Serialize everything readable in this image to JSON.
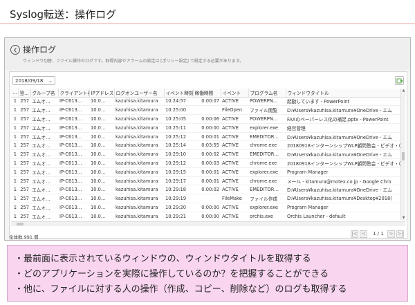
{
  "slide": {
    "title": "Syslog転送：操作ログ"
  },
  "window": {
    "title": "操作ログ",
    "description": "ウィンドウ切替、ファイル操作のログです。取得内容やアラームの設定は [ポリシー設定] で設定する必要があります。"
  },
  "filter": {
    "date": "2018/09/18"
  },
  "table": {
    "columns": [
      "…",
      "登…",
      "グループ名",
      "クライアント名",
      "IPアドレス",
      "ログオンユーザー名",
      "イベント時刻",
      "稼働時間",
      "イベント",
      "プログラム名",
      "ウィンドウタイトル"
    ],
    "rows": [
      [
        "1",
        "257",
        "エムオ…",
        "IP-C613…",
        "10.0…",
        "kazuhisa.kitamura",
        "10:24:57",
        "0:00:07",
        "ACTIVE",
        "POWERPN…",
        "起動しています - PowerPoint"
      ],
      [
        "1",
        "257",
        "エムオ…",
        "IP-C613…",
        "10.0…",
        "kazuhisa.kitamura",
        "10:25:00",
        "",
        "FileOpen",
        "ファイル閲覧",
        "D:¥Users¥kazuhisa.kitamura¥OneDrive - エム"
      ],
      [
        "1",
        "257",
        "エムオ…",
        "IP-C613…",
        "10.0…",
        "kazuhisa.kitamura",
        "10:25:05",
        "0:00:06",
        "ACTIVE",
        "POWERPN…",
        "FAXのペーパーレス化の補足.pptx - PowerPoint"
      ],
      [
        "1",
        "257",
        "エムオ…",
        "IP-C613…",
        "10.0…",
        "kazuhisa.kitamura",
        "10:25:11",
        "0:00:00",
        "ACTIVE",
        "explorer.exe",
        "経営管理"
      ],
      [
        "1",
        "257",
        "エムオ…",
        "IP-C613…",
        "10.0…",
        "kazuhisa.kitamura",
        "10:25:12",
        "0:00:01",
        "ACTIVE",
        "EMEDITOR…",
        "D:¥Users¥kazuhisa.kitamura¥OneDrive - エム"
      ],
      [
        "1",
        "257",
        "エムオ…",
        "IP-C613…",
        "10.0…",
        "kazuhisa.kitamura",
        "10:25:14",
        "0:03:55",
        "ACTIVE",
        "chrome.exe",
        "20180918インターンシップWLP顧問塾会 - ビデオ・("
      ],
      [
        "1",
        "257",
        "エムオ…",
        "IP-C613…",
        "10.0…",
        "kazuhisa.kitamura",
        "10:29:10",
        "0:00:02",
        "ACTIVE",
        "EMEDITOR…",
        "D:¥Users¥kazuhisa.kitamura¥OneDrive - エム"
      ],
      [
        "1",
        "257",
        "エムオ…",
        "IP-C613…",
        "10.0…",
        "kazuhisa.kitamura",
        "10:29:12",
        "0:00:03",
        "ACTIVE",
        "chrome.exe",
        "20180918インターンシップWLP顧問塾会 - ビデオ・("
      ],
      [
        "1",
        "257",
        "エムオ…",
        "IP-C613…",
        "10.0…",
        "kazuhisa.kitamura",
        "10:29:15",
        "0:00:01",
        "ACTIVE",
        "explorer.exe",
        "Program Manager"
      ],
      [
        "1",
        "257",
        "エムオ…",
        "IP-C613…",
        "10.0…",
        "kazuhisa.kitamura",
        "10:29:17",
        "0:00:01",
        "ACTIVE",
        "chrome.exe",
        "メール - kitamura@motex.co.jp - Google Chro"
      ],
      [
        "1",
        "257",
        "エムオ…",
        "IP-C613…",
        "10.0…",
        "kazuhisa.kitamura",
        "10:29:18",
        "0:00:02",
        "ACTIVE",
        "EMEDITOR…",
        "D:¥Users¥kazuhisa.kitamura¥OneDrive - エム"
      ],
      [
        "1",
        "257",
        "エムオ…",
        "IP-C613…",
        "10.0…",
        "kazuhisa.kitamura",
        "10:29:19",
        "",
        "FileMake",
        "ファイル作成",
        "D:¥Users¥kazuhisa.kitamura¥Desktop¥2018("
      ],
      [
        "1",
        "257",
        "エムオ…",
        "IP-C613…",
        "10.0…",
        "kazuhisa.kitamura",
        "10:29:20",
        "0:00:00",
        "ACTIVE",
        "explorer.exe",
        "Program Manager"
      ],
      [
        "1",
        "257",
        "エムオ…",
        "IP-C613…",
        "10.0…",
        "kazuhisa.kitamura",
        "10:29:21",
        "0:00:00",
        "ACTIVE",
        "orchis.exe",
        "Orchis Launcher - default"
      ]
    ]
  },
  "footer": {
    "total": "全体数 991 個",
    "page": "1 / 1"
  },
  "notes": [
    "・最前面に表示されているウィンドウの、ウィンドウタイトルを取得する",
    "・どのアプリケーションを実際に操作しているのか？を把握することができる",
    "・他に、ファイルに対する人の操作（作成、コピー、削除など）のログも取得する"
  ]
}
